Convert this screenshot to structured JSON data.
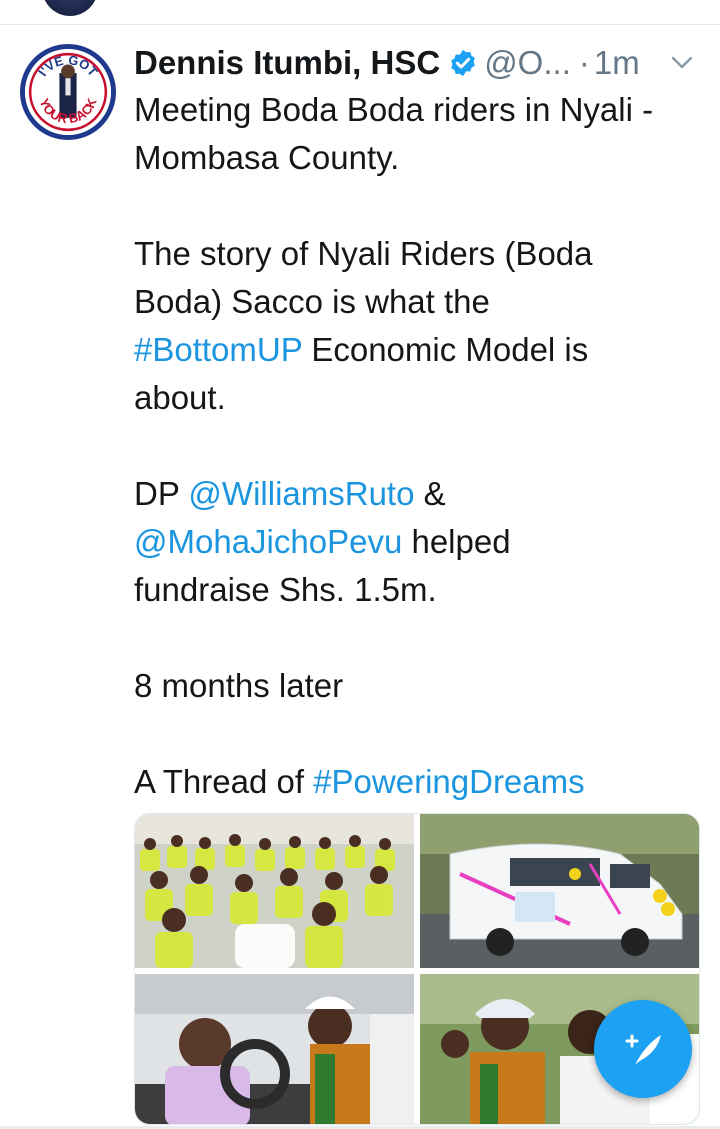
{
  "tweet": {
    "author_name": "Dennis Itumbi, HSC",
    "handle": "@O...",
    "separator": "·",
    "timestamp": "1m",
    "avatar_badge_top": "I'VE GOT",
    "avatar_badge_bottom": "YOUR BACK",
    "lines": [
      "Meeting Boda Boda riders in Nyali -",
      "Mombasa County.",
      "The story of Nyali Riders (Boda",
      "Boda) Sacco is what the",
      "#BottomUP",
      " Economic Model is",
      "about.",
      "DP ",
      "@WilliamsRuto",
      " &",
      "@MohaJichoPevu",
      " helped",
      "fundraise Shs. 1.5m.",
      "8 months later",
      "A Thread of ",
      "#PoweringDreams"
    ]
  },
  "colors": {
    "link": "#1b95e0",
    "fab": "#1da1f2",
    "verified": "#1da1f2",
    "muted": "#657786"
  },
  "icons": {
    "verified": "verified-badge-icon",
    "more": "chevron-down-icon",
    "compose": "compose-tweet-icon"
  }
}
